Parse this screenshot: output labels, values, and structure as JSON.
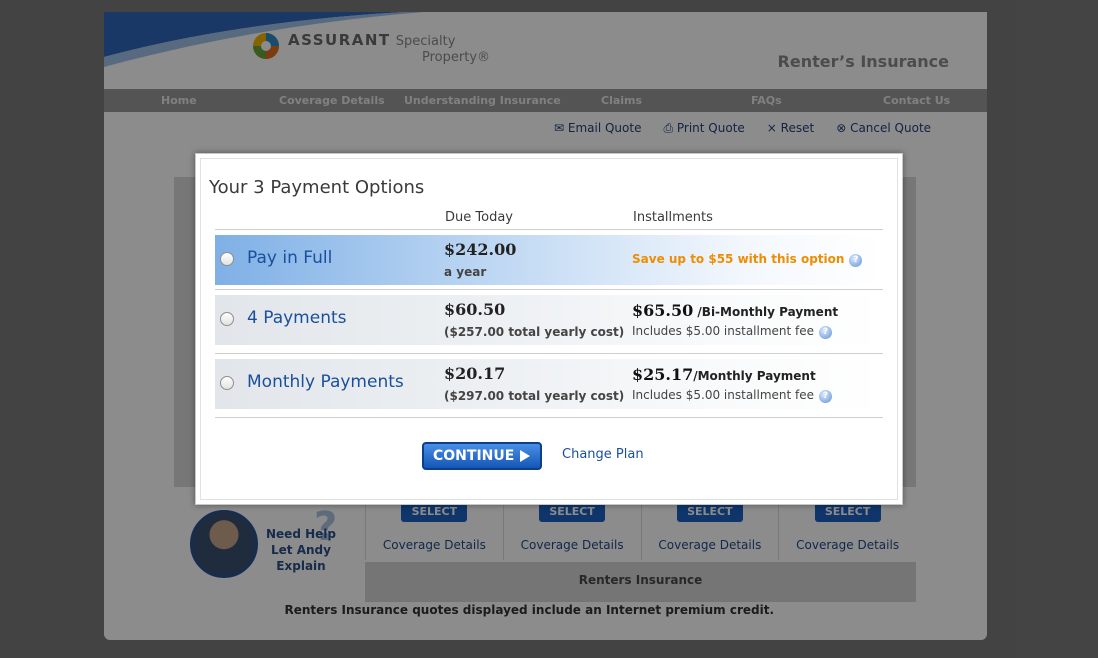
{
  "header": {
    "brand": "ASSURANT",
    "brand_sub1": "Specialty",
    "brand_sub2": "Property®",
    "site_title": "Renter’s Insurance"
  },
  "nav": {
    "items": [
      "Home",
      "Coverage Details",
      "Understanding Insurance",
      "Claims",
      "FAQs",
      "Contact Us"
    ]
  },
  "tools": {
    "email": "Email Quote",
    "print": "Print Quote",
    "reset": "Reset",
    "cancel": "Cancel Quote"
  },
  "help": {
    "line1": "Need Help",
    "line2": "Let Andy Explain"
  },
  "plans": {
    "select_label": "SELECT",
    "coverage_link": "Coverage Details",
    "bar_label": "Renters Insurance",
    "footnote": "Renters Insurance quotes displayed include an Internet premium credit."
  },
  "modal": {
    "title": "Your 3 Payment Options",
    "col_due": "Due Today",
    "col_installments": "Installments",
    "options": [
      {
        "label": "Pay in Full",
        "price": "$242.00",
        "price_sub": "a year",
        "note": "Save up to $55 with this option"
      },
      {
        "label": "4 Payments",
        "price": "$60.50",
        "price_sub": "($257.00 total yearly cost)",
        "inst_amount": "$65.50",
        "inst_period": " /Bi-Monthly Payment",
        "inst_fee": "Includes $5.00 installment fee"
      },
      {
        "label": "Monthly Payments",
        "price": "$20.17",
        "price_sub": "($297.00 total yearly cost)",
        "inst_amount": "$25.17",
        "inst_period": "/Monthly Payment",
        "inst_fee": "Includes $5.00 installment fee"
      }
    ],
    "continue_label": "CONTINUE",
    "change_plan": "Change Plan"
  },
  "colors": {
    "accent": "#1a4f9c",
    "save_note": "#f08c00"
  }
}
